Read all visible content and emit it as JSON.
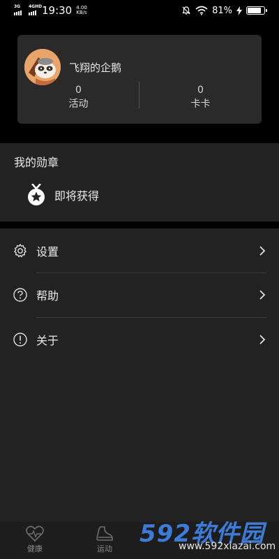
{
  "status_bar": {
    "network_1": "3G",
    "network_2": "4GHD",
    "time": "19:30",
    "speed_value": "4.00",
    "speed_unit": "KB/s",
    "battery_percent": "81%",
    "battery_level": 0.81
  },
  "profile": {
    "username": "飞翔的企鹅",
    "stats": [
      {
        "value": "0",
        "label": "活动"
      },
      {
        "value": "0",
        "label": "卡卡"
      }
    ]
  },
  "medals": {
    "title": "我的勋章",
    "item_label": "即将获得"
  },
  "menu": {
    "items": [
      {
        "label": "设置",
        "icon": "gear-icon"
      },
      {
        "label": "帮助",
        "icon": "question-circle-icon"
      },
      {
        "label": "关于",
        "icon": "info-circle-icon"
      }
    ]
  },
  "bottom_nav": {
    "items": [
      {
        "label": "健康",
        "icon": "heart-pulse-icon"
      },
      {
        "label": "运动",
        "icon": "sneaker-icon"
      }
    ]
  },
  "watermark": {
    "brand": "592软件园",
    "url": "www.592xiazai.com"
  },
  "colors": {
    "background": "#000000",
    "card": "#2a2a2a",
    "section": "#222222",
    "watermark_blue": "#3c7bd6"
  }
}
